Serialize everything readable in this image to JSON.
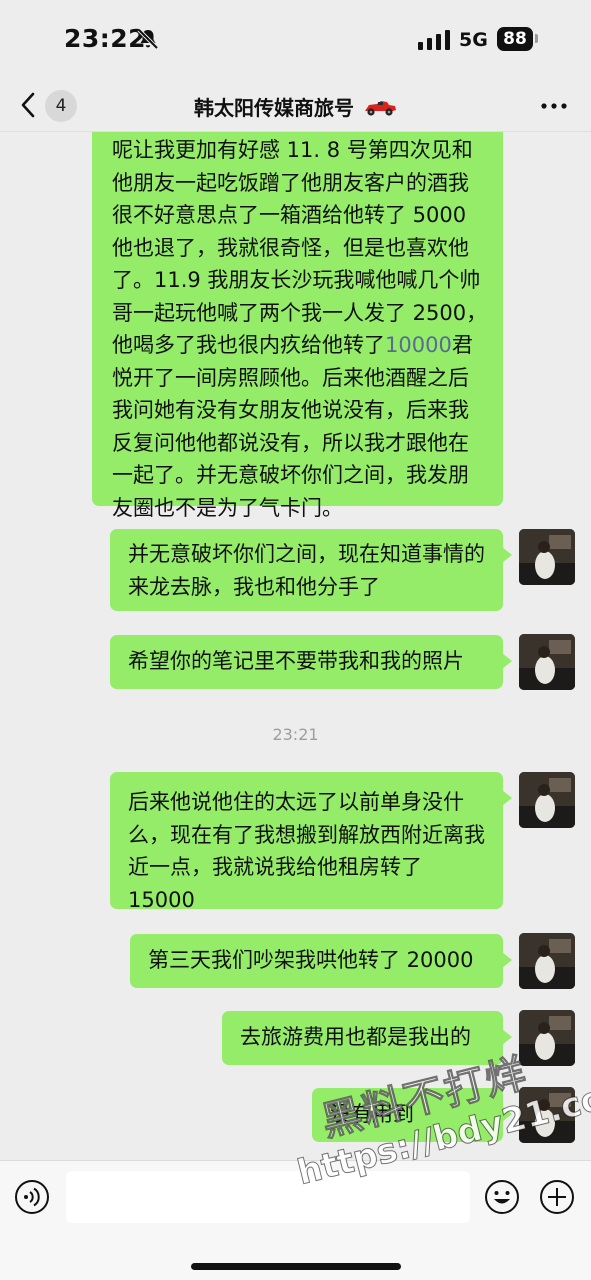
{
  "status_bar": {
    "time": "23:22",
    "network": "5G",
    "battery": "88"
  },
  "nav": {
    "unread_count": "4",
    "title": "韩太阳传媒商旅号"
  },
  "messages": [
    {
      "from": "self",
      "text_before": "呢让我更加有好感 11. 8 号第四次见和他朋友一起吃饭蹭了他朋友客户的酒我很不好意思点了一箱酒给他转了 5000 他也退了，我就很奇怪，但是也喜欢他了。11.9 我朋友长沙玩我喊他喊几个帅哥一起玩他喊了两个我一人发了 2500，他喝多了我也很内疚给他转了",
      "link": "10000",
      "text_after": "君悦开了一间房照顾他。后来他酒醒之后我问她有没有女朋友他说没有，后来我反复问他他都说没有，所以我才跟他在一起了。并无意破坏你们之间，我发朋友圈也不是为了气卡门。"
    },
    {
      "from": "self",
      "text": "并无意破坏你们之间，现在知道事情的来龙去脉，我也和他分手了"
    },
    {
      "from": "self",
      "text": "希望你的笔记里不要带我和我的照片"
    },
    {
      "from": "self",
      "text": "后来他说他住的太远了以前单身没什么，现在有了我想搬到解放西附近离我近一点，我就说我给他租房转了 15000"
    },
    {
      "from": "self",
      "text": "第三天我们吵架我哄他转了 20000"
    },
    {
      "from": "self",
      "text": "去旅游费用也都是我出的"
    },
    {
      "from": "self",
      "text": "没有用到"
    }
  ],
  "timestamp": "23:21",
  "input": {
    "value": "",
    "placeholder": ""
  },
  "watermark": {
    "line1": "黑料不打烊",
    "line2": "https://bdy21.co"
  },
  "colors": {
    "background": "#ededed",
    "bubble_self": "#95ec69",
    "link": "#576b95",
    "timestamp": "#9e9e9e"
  },
  "icons": [
    "bell-mute-icon",
    "signal-icon",
    "back-chevron-icon",
    "race-car-icon",
    "more-icon",
    "voice-icon",
    "emoji-icon",
    "plus-icon"
  ]
}
